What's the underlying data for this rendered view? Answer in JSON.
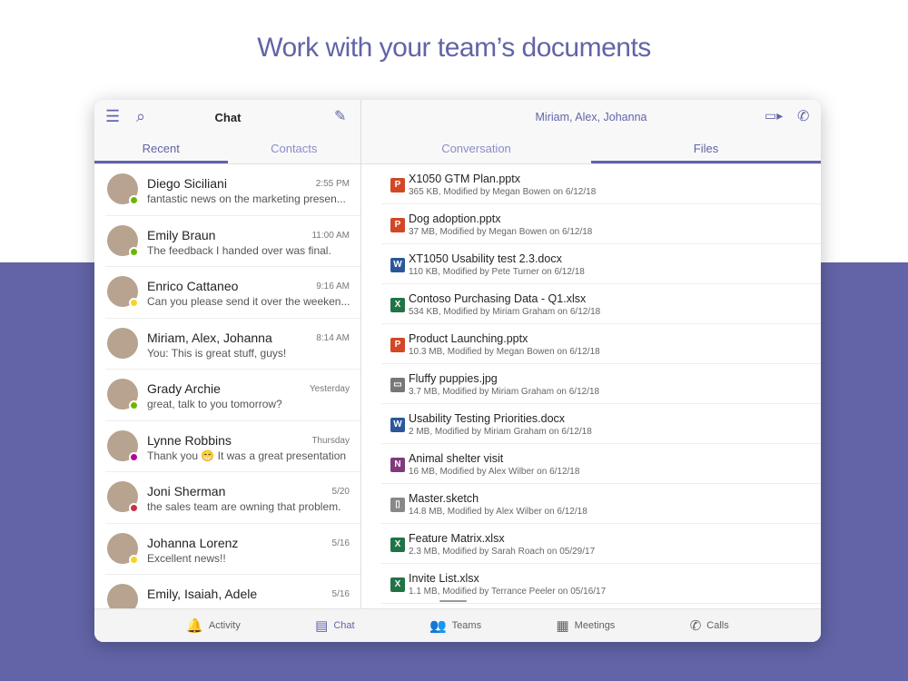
{
  "headline": "Work with your team’s documents",
  "colors": {
    "accent": "#6264a7",
    "band": "#6264a7"
  },
  "left": {
    "title": "Chat",
    "tabs": [
      "Recent",
      "Contacts"
    ],
    "chats": [
      {
        "name": "Diego Siciliani",
        "time": "2:55 PM",
        "preview": "fantastic news on the marketing presen...",
        "status": "#6bb700"
      },
      {
        "name": "Emily Braun",
        "time": "11:00 AM",
        "preview": "The feedback I handed over was final.",
        "status": "#6bb700"
      },
      {
        "name": "Enrico Cattaneo",
        "time": "9:16 AM",
        "preview": "Can you please send it over the weeken...",
        "status": "#f8d22a"
      },
      {
        "name": "Miriam, Alex, Johanna",
        "time": "8:14 AM",
        "preview": "You: This is great stuff, guys!",
        "status": ""
      },
      {
        "name": "Grady Archie",
        "time": "Yesterday",
        "preview": "great, talk to you tomorrow?",
        "status": "#6bb700"
      },
      {
        "name": "Lynne Robbins",
        "time": "Thursday",
        "preview": "Thank you 😁 It was a great presentation",
        "status": "#b4009e"
      },
      {
        "name": "Joni Sherman",
        "time": "5/20",
        "preview": "the sales team are owning that problem.",
        "status": "#c4314b"
      },
      {
        "name": "Johanna Lorenz",
        "time": "5/16",
        "preview": "Excellent news!!",
        "status": "#f8d22a"
      },
      {
        "name": "Emily, Isaiah, Adele",
        "time": "5/16",
        "preview": "",
        "status": ""
      }
    ]
  },
  "right": {
    "title": "Miriam, Alex, Johanna",
    "tabs": [
      "Conversation",
      "Files"
    ],
    "files": [
      {
        "name": "X1050 GTM Plan.pptx",
        "meta": "365 KB, Modified by Megan Bowen on 6/12/18",
        "type": "P",
        "color": "#d24726"
      },
      {
        "name": "Dog adoption.pptx",
        "meta": "37 MB, Modified by Megan Bowen on 6/12/18",
        "type": "P",
        "color": "#d24726"
      },
      {
        "name": "XT1050 Usability test 2.3.docx",
        "meta": "110 KB, Modified by Pete Turner on 6/12/18",
        "type": "W",
        "color": "#2b579a"
      },
      {
        "name": "Contoso Purchasing Data - Q1.xlsx",
        "meta": "534 KB, Modified by Miriam Graham on 6/12/18",
        "type": "X",
        "color": "#217346"
      },
      {
        "name": "Product Launching.pptx",
        "meta": "10.3 MB, Modified by Megan Bowen on 6/12/18",
        "type": "P",
        "color": "#d24726"
      },
      {
        "name": "Fluffy puppies.jpg",
        "meta": "3.7 MB, Modified by Miriam Graham on 6/12/18",
        "type": "▭",
        "color": "#777777"
      },
      {
        "name": "Usability Testing Priorities.docx",
        "meta": "2 MB, Modified by Miriam Graham on 6/12/18",
        "type": "W",
        "color": "#2b579a"
      },
      {
        "name": "Animal shelter visit",
        "meta": "16 MB, Modified by Alex Wilber on 6/12/18",
        "type": "N",
        "color": "#80397b"
      },
      {
        "name": "Master.sketch",
        "meta": "14.8 MB, Modified by Alex Wilber on 6/12/18",
        "type": "▯",
        "color": "#888888"
      },
      {
        "name": "Feature Matrix.xlsx",
        "meta": "2.3 MB, Modified by Sarah Roach on 05/29/17",
        "type": "X",
        "color": "#217346"
      },
      {
        "name": "Invite List.xlsx",
        "meta": "1.1 MB, Modified by Terrance Peeler on 05/16/17",
        "type": "X",
        "color": "#217346"
      }
    ]
  },
  "nav": [
    {
      "label": "Activity",
      "icon": "🔔"
    },
    {
      "label": "Chat",
      "icon": "▤"
    },
    {
      "label": "Teams",
      "icon": "👥"
    },
    {
      "label": "Meetings",
      "icon": "▦"
    },
    {
      "label": "Calls",
      "icon": "✆"
    }
  ]
}
